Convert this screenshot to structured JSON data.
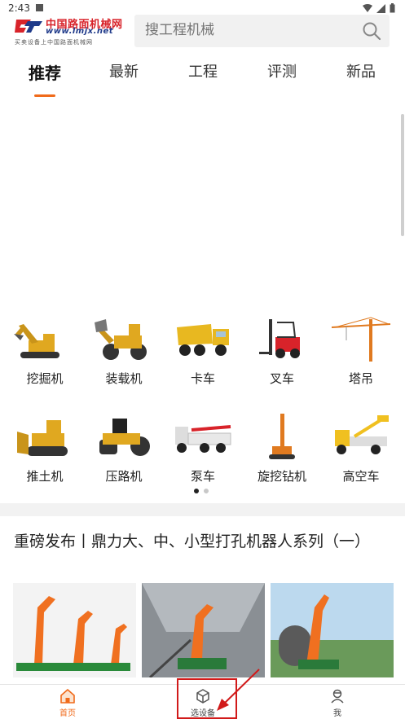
{
  "status_bar": {
    "time": "2:43"
  },
  "header": {
    "logo_cn": "中国路面机械网",
    "logo_url": "www.lmjx.net",
    "logo_slogan": "买卖设备上中国路面机械网",
    "search_placeholder": "搜工程机械"
  },
  "tabs": [
    {
      "label": "推荐",
      "active": true
    },
    {
      "label": "最新",
      "active": false
    },
    {
      "label": "工程",
      "active": false
    },
    {
      "label": "评测",
      "active": false
    },
    {
      "label": "新品",
      "active": false
    }
  ],
  "categories": [
    {
      "label": "挖掘机",
      "icon": "excavator-icon"
    },
    {
      "label": "装载机",
      "icon": "loader-icon"
    },
    {
      "label": "卡车",
      "icon": "dump-truck-icon"
    },
    {
      "label": "叉车",
      "icon": "forklift-icon"
    },
    {
      "label": "塔吊",
      "icon": "tower-crane-icon"
    },
    {
      "label": "推土机",
      "icon": "bulldozer-icon"
    },
    {
      "label": "压路机",
      "icon": "road-roller-icon"
    },
    {
      "label": "泵车",
      "icon": "pump-truck-icon"
    },
    {
      "label": "旋挖钻机",
      "icon": "rotary-drill-icon"
    },
    {
      "label": "高空车",
      "icon": "aerial-platform-icon"
    }
  ],
  "pager": {
    "pages": 2,
    "current": 1
  },
  "article": {
    "title": "重磅发布丨鼎力大、中、小型打孔机器人系列（一）"
  },
  "bottom_nav": [
    {
      "label": "首页",
      "icon": "home-icon",
      "active": true
    },
    {
      "label": "选设备",
      "icon": "cube-icon",
      "active": false
    },
    {
      "label": "我",
      "icon": "user-icon",
      "active": false
    }
  ],
  "colors": {
    "accent": "#f06a1a",
    "annotation": "#d11a1a",
    "logo_red": "#d8232a",
    "logo_blue": "#1f3a8a"
  }
}
